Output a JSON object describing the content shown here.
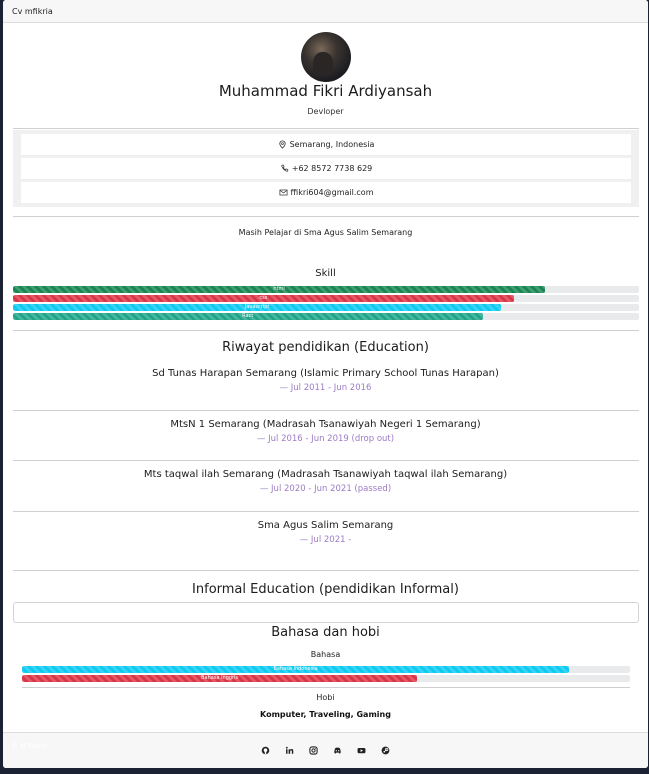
{
  "window": {
    "title": "Cv mfikria"
  },
  "profile": {
    "name": "Muhammad Fikri Ardiyansah",
    "role": "Devloper"
  },
  "contacts": [
    {
      "icon": "map-pin-icon",
      "text": "Semarang, Indonesia"
    },
    {
      "icon": "phone-icon",
      "text": "+62 8572 7738 629"
    },
    {
      "icon": "mail-icon",
      "text": "ffikri604@gmail.com"
    }
  ],
  "about": "Masih Pelajar di Sma Agus Salim Semarang",
  "skills": {
    "title": "Skill",
    "items": [
      {
        "label": "html",
        "value": 85,
        "color": "#198754"
      },
      {
        "label": "css",
        "value": 80,
        "color": "#dc3545"
      },
      {
        "label": "Javascript",
        "value": 78,
        "color": "#0dcaf0"
      },
      {
        "label": "Ract",
        "value": 75,
        "color": "#20a58a"
      }
    ]
  },
  "education": {
    "title": "Riwayat pendidikan (Education)",
    "items": [
      {
        "school": "Sd Tunas Harapan Semarang (Islamic Primary School Tunas Harapan)",
        "period": "— Jul 2011 - Jun 2016"
      },
      {
        "school": "MtsN 1 Semarang (Madrasah Tsanawiyah Negeri 1 Semarang)",
        "period": "— Jul 2016 - Jun 2019 (drop out)"
      },
      {
        "school": "Mts taqwal ilah Semarang (Madrasah Tsanawiyah taqwal ilah Semarang)",
        "period": "— Jul 2020 - Jun 2021 (passed)"
      },
      {
        "school": "Sma Agus Salim Semarang",
        "period": "— Jul 2021 -"
      }
    ]
  },
  "informal": {
    "title": "Informal Education (pendidikan Informal)"
  },
  "languages": {
    "title": "Bahasa dan hobi",
    "subtitle": "Bahasa",
    "items": [
      {
        "label": "Bahasa Indonesia",
        "value": 90,
        "color": "#0dcaf0"
      },
      {
        "label": "Bahasa Inggris",
        "value": 65,
        "color": "#dc3545"
      }
    ]
  },
  "hobby": {
    "title": "Hobi",
    "text": "Komputer, Traveling, Gaming"
  },
  "footer": {
    "copyright": "© M Fikria",
    "socials": [
      "github-icon",
      "linkedin-icon",
      "instagram-icon",
      "discord-icon",
      "youtube-icon",
      "steam-icon"
    ]
  }
}
